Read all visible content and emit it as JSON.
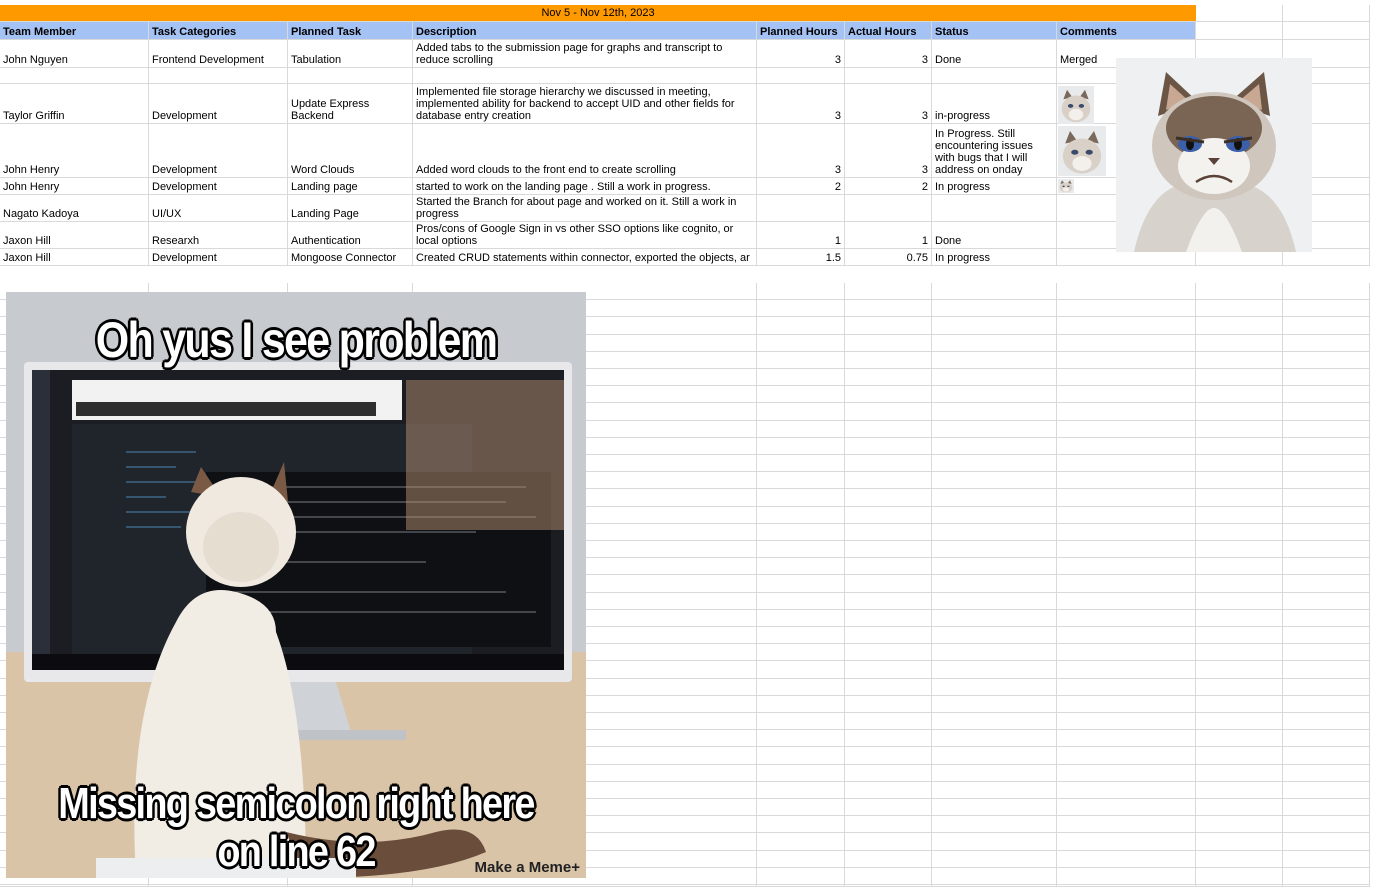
{
  "banner": "Nov 5 - Nov 12th, 2023",
  "headers": [
    "Team Member",
    "Task Categories",
    "Planned Task",
    "Description",
    "Planned Hours",
    "Actual Hours",
    "Status",
    "Comments"
  ],
  "rows": [
    [
      "John Nguyen",
      "Frontend Development",
      "Tabulation",
      "Added tabs to the submission page for graphs and transcript to reduce scrolling",
      "3",
      "3",
      "Done",
      "Merged"
    ],
    [
      "",
      "",
      "",
      "",
      "",
      "",
      "",
      ""
    ],
    [
      "Taylor Griffin",
      "Development",
      "Update Express Backend",
      "Implemented file storage hierarchy we discussed in meeting, implemented ability for backend to accept UID and other fields for database entry creation",
      "3",
      "3",
      "in-progress",
      ""
    ],
    [
      "John Henry",
      "Development",
      "Word Clouds",
      "Added word clouds to the front end to create scrolling",
      "3",
      "3",
      "In Progress. Still encountering issues with bugs that I will address on onday",
      ""
    ],
    [
      "John Henry",
      "Development",
      "Landing page",
      "started to work on the landing page . Still a work in progress.",
      "2",
      "2",
      "In progress",
      ""
    ],
    [
      "Nagato Kadoya",
      "UI/UX",
      "Landing Page",
      "Started the Branch for about page and worked on it. Still a work in progress",
      "",
      "",
      "",
      ""
    ],
    [
      "Jaxon Hill",
      "Researxh",
      "Authentication",
      "Pros/cons of Google Sign in vs other SSO options like cognito, or local options",
      "1",
      "1",
      "Done",
      ""
    ],
    [
      "Jaxon Hill",
      "Development",
      "Mongoose Connector",
      "Created CRUD statements within connector, exported the objects, ar",
      "1.5",
      "0.75",
      "In progress",
      ""
    ]
  ],
  "meme": {
    "top_text": "Oh yus I see problem",
    "bottom_text": "Missing semicolon right here on line 62",
    "watermark": "Make a Meme+"
  },
  "colors": {
    "banner": "#ff9900",
    "header": "#a4c2f4",
    "grid": "#d9d9d9"
  }
}
